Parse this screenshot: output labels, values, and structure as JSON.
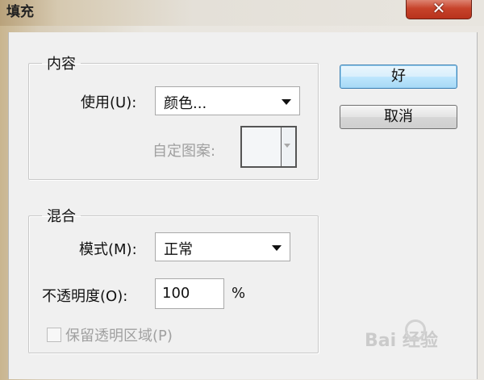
{
  "window": {
    "title": "填充",
    "close_glyph": "✕"
  },
  "content_group": {
    "legend": "内容",
    "use_label": "使用(U):",
    "use_value": "颜色...",
    "custom_pattern_label": "自定图案:"
  },
  "blend_group": {
    "legend": "混合",
    "mode_label": "模式(M):",
    "mode_value": "正常",
    "opacity_label": "不透明度(O):",
    "opacity_value": "100",
    "opacity_unit": "%",
    "preserve_transparency_label": "保留透明区域(P)",
    "preserve_transparency_checked": false
  },
  "buttons": {
    "ok_label": "好",
    "cancel_label": "取消"
  },
  "watermark": {
    "text": "Bai 经验"
  },
  "colors": {
    "default_button": "#bee6fd",
    "close_button": "#c7432b",
    "disabled_text": "#a0a0a0"
  }
}
